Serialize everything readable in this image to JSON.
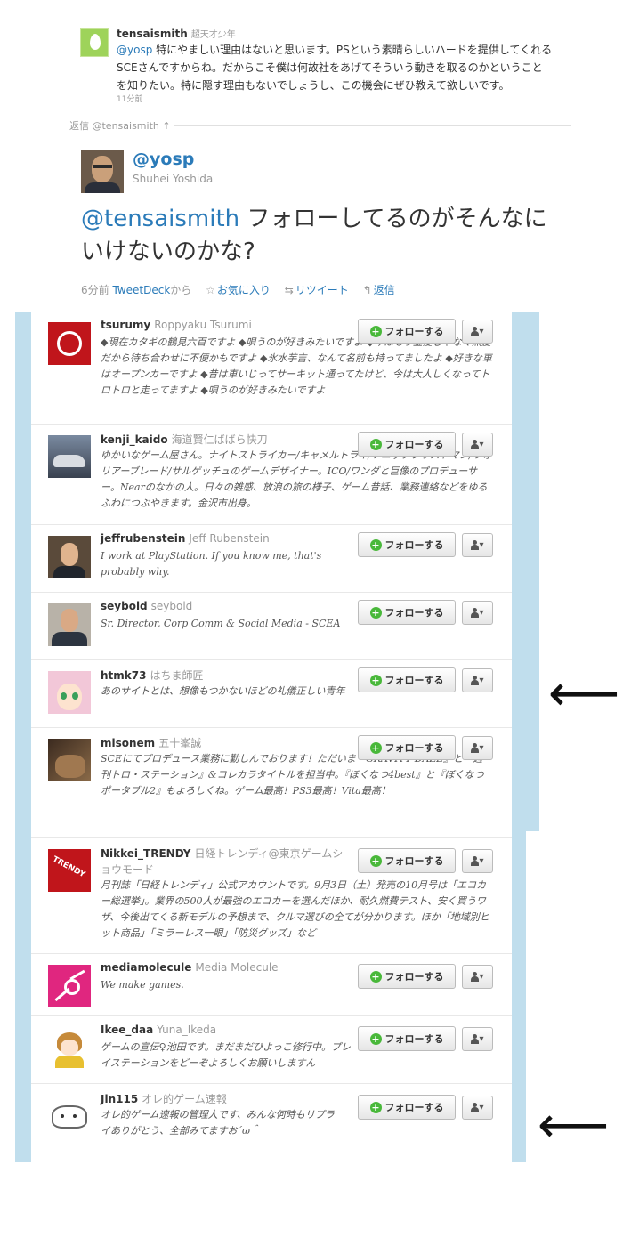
{
  "reply_tweet": {
    "handle": "tensaismith",
    "full_name": "超天才少年",
    "mention": "@yosp",
    "text": " 特にやましい理由はないと思います。PSという素晴らしいハードを提供してくれるSCEさんですからね。だからこそ僕は何故社をあげてそういう動きを取るのかということを知りたい。特に隠す理由もないでしょうし、この機会にぜひ教えて欲しいです。",
    "time": "11分前"
  },
  "in_reply_to": "返信 @tensaismith ↑",
  "main_tweet": {
    "handle": "@yosp",
    "full_name": "Shuhei Yoshida",
    "mention": "@tensaismith",
    "text": " フォローしてるのがそんなにいけないのかな?",
    "time": "6分前",
    "via": "TweetDeck",
    "via_suffix": "から",
    "favorite": "お気に入り",
    "retweet": "リツイート",
    "reply": "返信"
  },
  "follow_button_label": "フォローする",
  "users": [
    {
      "handle": "tsurumy",
      "full_name": "Roppyaku Tsurumi",
      "bio": "◆現在カタギの鶴見六百ですよ ◆唄うのが好きみたいですよ ◆今はもう金髪じゃなく黒髪だから待ち合わせに不便かもですよ ◆氷水芋吉、なんて名前も持ってましたよ ◆好きな車はオープンカーですよ ◆昔は車いじってサーキット通ってたけど、今は大人しくなってトロトロと走ってますよ ◆唄うのが好きみたいですよ"
    },
    {
      "handle": "kenji_kaido",
      "full_name": "海道賢仁ばばら快刀",
      "bio": "ゆかいなゲーム屋さん。ナイトストライカー/キャメルトライ/ソニックブラストマン/ウォリアーブレード/サルゲッチュのゲームデザイナー。ICO/ワンダと巨像のプロデューサー。Nearのなかの人。日々の雑感、放浪の旅の様子、ゲーム昔話、業務連絡などをゆるふわにつぶやきます。金沢市出身。"
    },
    {
      "handle": "jeffrubenstein",
      "full_name": "Jeff Rubenstein",
      "bio": "I work at PlayStation. If you know me, that's probably why."
    },
    {
      "handle": "seybold",
      "full_name": "seybold",
      "bio": "Sr. Director, Corp Comm & Social Media - SCEA"
    },
    {
      "handle": "htmk73",
      "full_name": "はちま師匠",
      "bio": "あのサイトとは、想像もつかないほどの礼儀正しい青年"
    },
    {
      "handle": "misonem",
      "full_name": "五十峯誠",
      "bio": "SCEにてプロデュース業務に勤しんでおります！ただいま『GRAVITY DAZE』と『週刊トロ・ステーション』&コレカラタイトルを担当中。『ぼくなつ4best』と『ぼくなつポータブル2』もよろしくね。ゲーム最高！PS3最高！Vita最高！"
    },
    {
      "handle": "Nikkei_TRENDY",
      "full_name": "日経トレンディ@東京ゲームショウモード",
      "bio": "月刊誌「日経トレンディ」公式アカウントです。9月3日（土）発売の10月号は「エコカー総選挙」。業界の500人が最強のエコカーを選んだほか、耐久燃費テスト、安く買うワザ、今後出てくる新モデルの予想まで、クルマ選びの全てが分かります。ほか「地域別ヒット商品」「ミラーレス一眼」「防災グッズ」など"
    },
    {
      "handle": "mediamolecule",
      "full_name": "Media Molecule",
      "bio": "We make games."
    },
    {
      "handle": "Ikee_daa",
      "full_name": "Yuna_Ikeda",
      "bio": "ゲームの宣伝♀池田です。まだまだひよっこ修行中。プレイステーションをどーぞよろしくお願いしますん"
    },
    {
      "handle": "Jin115",
      "full_name": "オレ的ゲーム速報",
      "bio": "オレ的ゲーム速報の管理人です、みんな何時もリプライありがとう、全部みてますお´ω＾"
    }
  ],
  "arrow_glyph": "⟵"
}
